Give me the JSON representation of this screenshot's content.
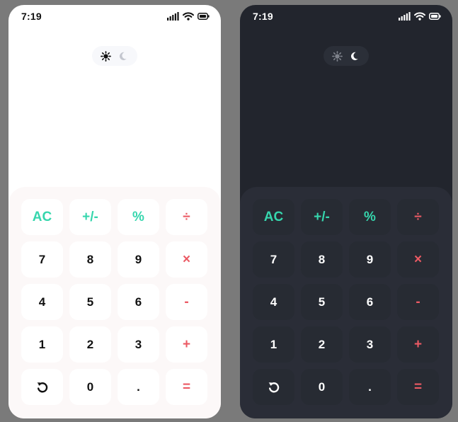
{
  "phones": [
    {
      "theme": "light",
      "time": "7:19",
      "keys": {
        "ac": "AC",
        "sign": "+/-",
        "percent": "%",
        "divide": "÷",
        "seven": "7",
        "eight": "8",
        "nine": "9",
        "multiply": "×",
        "four": "4",
        "five": "5",
        "six": "6",
        "minus": "-",
        "one": "1",
        "two": "2",
        "three": "3",
        "plus": "+",
        "zero": "0",
        "dot": ".",
        "equals": "="
      }
    },
    {
      "theme": "dark",
      "time": "7:19",
      "keys": {
        "ac": "AC",
        "sign": "+/-",
        "percent": "%",
        "divide": "÷",
        "seven": "7",
        "eight": "8",
        "nine": "9",
        "multiply": "×",
        "four": "4",
        "five": "5",
        "six": "6",
        "minus": "-",
        "one": "1",
        "two": "2",
        "three": "3",
        "plus": "+",
        "zero": "0",
        "dot": ".",
        "equals": "="
      }
    }
  ],
  "icons": {
    "theme_toggle": [
      "sun-icon",
      "moon-icon"
    ],
    "status": [
      "signal-icon",
      "wifi-icon",
      "battery-icon"
    ],
    "undo_key": "undo-icon"
  },
  "colors": {
    "function_key": "#36d6ad",
    "operator_key": "#eb5a64",
    "light_background": "#ffffff",
    "dark_background": "#22252d"
  }
}
